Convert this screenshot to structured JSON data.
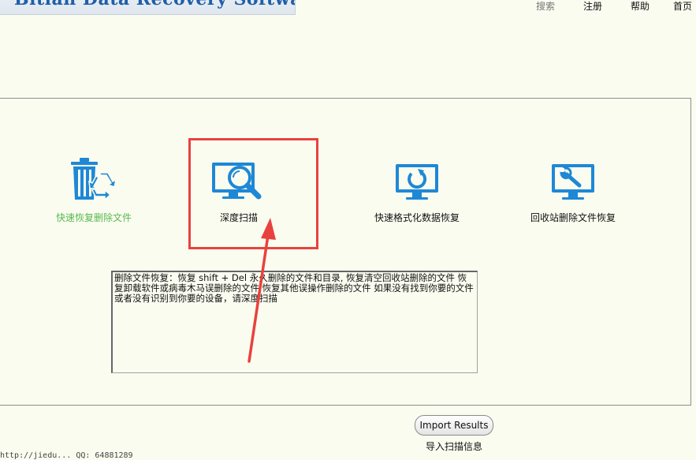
{
  "header": {
    "logo_text": "Bitian Data Recovery Software",
    "nav": {
      "search": "搜索",
      "register": "注册",
      "help": "帮助",
      "home": "首页"
    }
  },
  "options": {
    "quick_recover": "快速恢复删除文件",
    "deep_scan": "深度扫描",
    "format_recover": "快速格式化数据恢复",
    "recycle_recover": "回收站删除文件恢复"
  },
  "description": "删除文件恢复：恢复 shift + Del 永久删除的文件和目录, 恢复清空回收站删除的文件 恢复卸载软件或病毒木马误删除的文件 恢复其他误操作删除的文件 如果没有找到你要的文件或者没有识别到你要的设备，请深度扫描",
  "import": {
    "button_label": "Import Results",
    "caption": "导入扫描信息"
  },
  "status_bar": "http://jiedu...           QQ: 64881289",
  "colors": {
    "icon_blue": "#1e88d6",
    "highlight_red": "#e8423e",
    "quick_label_green": "#58b950"
  }
}
